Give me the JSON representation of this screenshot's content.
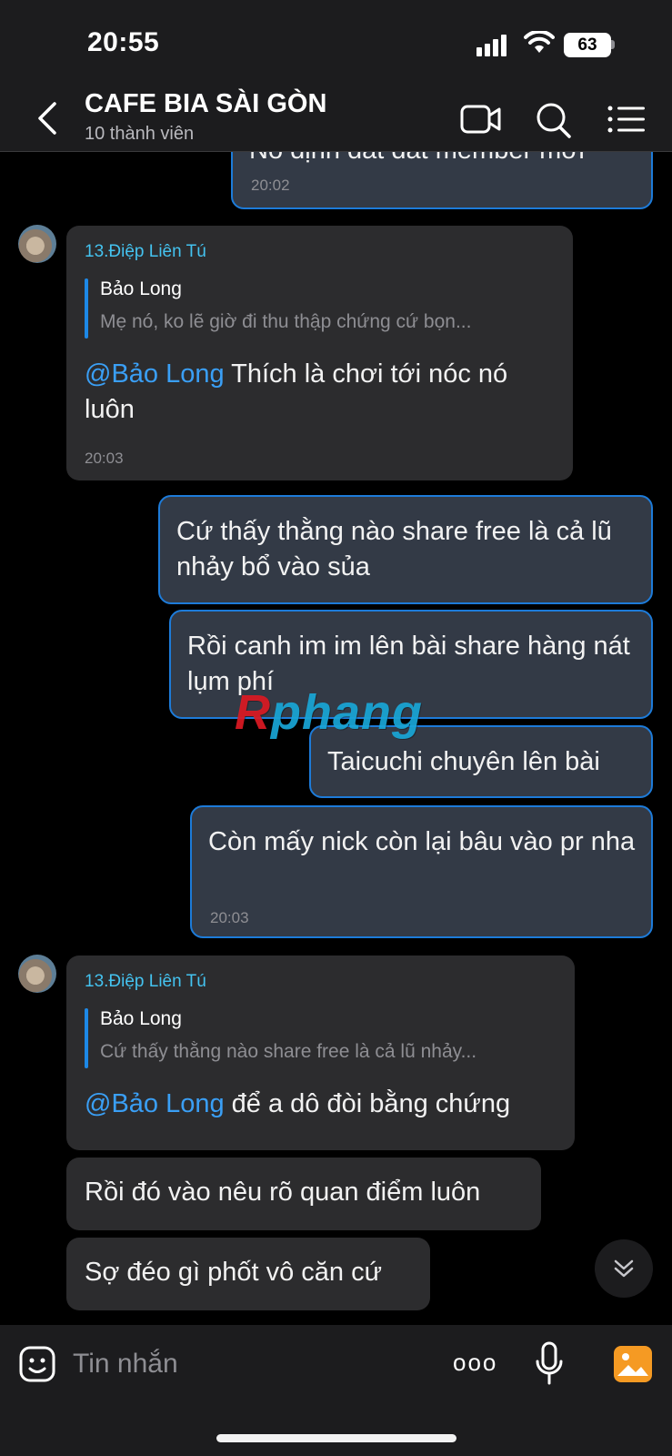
{
  "status_bar": {
    "time": "20:55",
    "battery": "63"
  },
  "header": {
    "title": "CAFE BIA SÀI GÒN",
    "subtitle": "10 thành viên",
    "icons": [
      "back-icon",
      "video-call-icon",
      "search-icon",
      "menu-list-icon"
    ]
  },
  "messages": {
    "m0": {
      "text": "Nó định dắt đất member mới",
      "time": "20:02"
    },
    "m1": {
      "sender": "13.Điệp Liên Tú",
      "quote_name": "Bảo Long",
      "quote_text": "Mẹ nó, ko lẽ giờ đi thu thập chứng cứ bọn...",
      "mention": "@Bảo Long",
      "text_line1": " Thích là chơi tới nóc nó",
      "text_line2": "luôn",
      "time": "20:03"
    },
    "m2": {
      "text": "Cứ thấy thằng nào share free là cả lũ nhảy bổ vào sủa"
    },
    "m3": {
      "text": "Rồi canh im im lên bài share hàng nát lụm phí"
    },
    "m4": {
      "text": "Taicuchi chuyên lên bài"
    },
    "m5": {
      "text": "Còn mấy nick còn lại bâu vào pr nha",
      "time": "20:03"
    },
    "m6": {
      "sender": "13.Điệp Liên Tú",
      "quote_name": "Bảo Long",
      "quote_text": "Cứ thấy thằng nào share free là cả lũ nhảy...",
      "mention": "@Bảo Long",
      "text": " để a dô đòi bằng chứng"
    },
    "m7": {
      "text": "Rồi đó vào nêu rõ quan điểm luôn"
    },
    "m8": {
      "text": "Sợ đéo gì phốt vô căn cứ"
    }
  },
  "watermark": {
    "part1": "R",
    "part2": "phang"
  },
  "composer": {
    "placeholder": "Tin nhắn",
    "more_label": "ooo"
  },
  "colors": {
    "accent": "#1d7bd9",
    "sender": "#44c3f0",
    "bubble_in": "#2c2c2e",
    "bubble_out": "#333a46"
  }
}
